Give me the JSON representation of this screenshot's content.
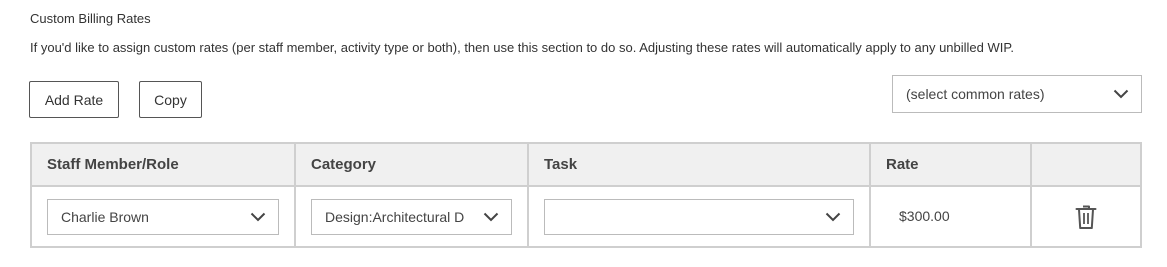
{
  "section": {
    "title": "Custom Billing Rates",
    "description": "If you'd like to assign custom rates (per staff member, activity type or both), then use this section to do so. Adjusting these rates will automatically apply to any unbilled WIP."
  },
  "toolbar": {
    "add_rate_label": "Add Rate",
    "copy_label": "Copy",
    "common_rates_placeholder": "(select common rates)"
  },
  "table": {
    "headers": [
      "Staff Member/Role",
      "Category",
      "Task",
      "Rate",
      ""
    ],
    "rows": [
      {
        "staff": "Charlie Brown",
        "category": "Design:Architectural D",
        "task": "",
        "rate": "$300.00"
      }
    ]
  },
  "icons": {
    "dropdown": "chevron-down-icon",
    "delete": "trash-icon"
  }
}
